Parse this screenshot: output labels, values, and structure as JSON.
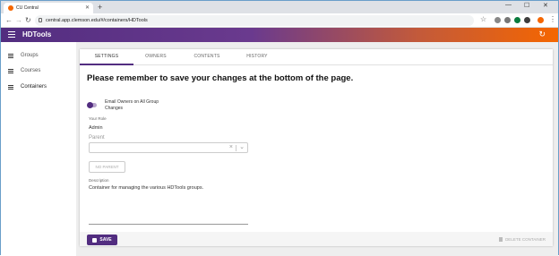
{
  "browser": {
    "tab_title": "CU Central",
    "new_tab": "+",
    "url": "central.app.clemson.edu/#/containers/HDTools",
    "win_min": "—",
    "win_max": "☐",
    "win_close": "✕"
  },
  "app": {
    "title": "HDTools",
    "refresh_icon": "refresh-icon"
  },
  "sidebar": {
    "items": [
      {
        "label": "Groups"
      },
      {
        "label": "Courses"
      },
      {
        "label": "Containers"
      }
    ]
  },
  "tabs": [
    {
      "label": "SETTINGS"
    },
    {
      "label": "OWNERS"
    },
    {
      "label": "CONTENTS"
    },
    {
      "label": "HISTORY"
    }
  ],
  "main": {
    "heading": "Please remember to save your changes at the bottom of the page.",
    "toggle_label": "Email Owners on All Group Changes",
    "role_label": "Your Role",
    "role_value": "Admin",
    "parent_label": "Parent",
    "no_parent_button": "NO PARENT",
    "description_label": "Description",
    "description_value": "Container for managing the various HDTools groups."
  },
  "footer": {
    "save_label": "SAVE",
    "delete_label": "DELETE CONTAINER"
  },
  "colors": {
    "accent": "#522d80",
    "brand_orange": "#f56600"
  }
}
